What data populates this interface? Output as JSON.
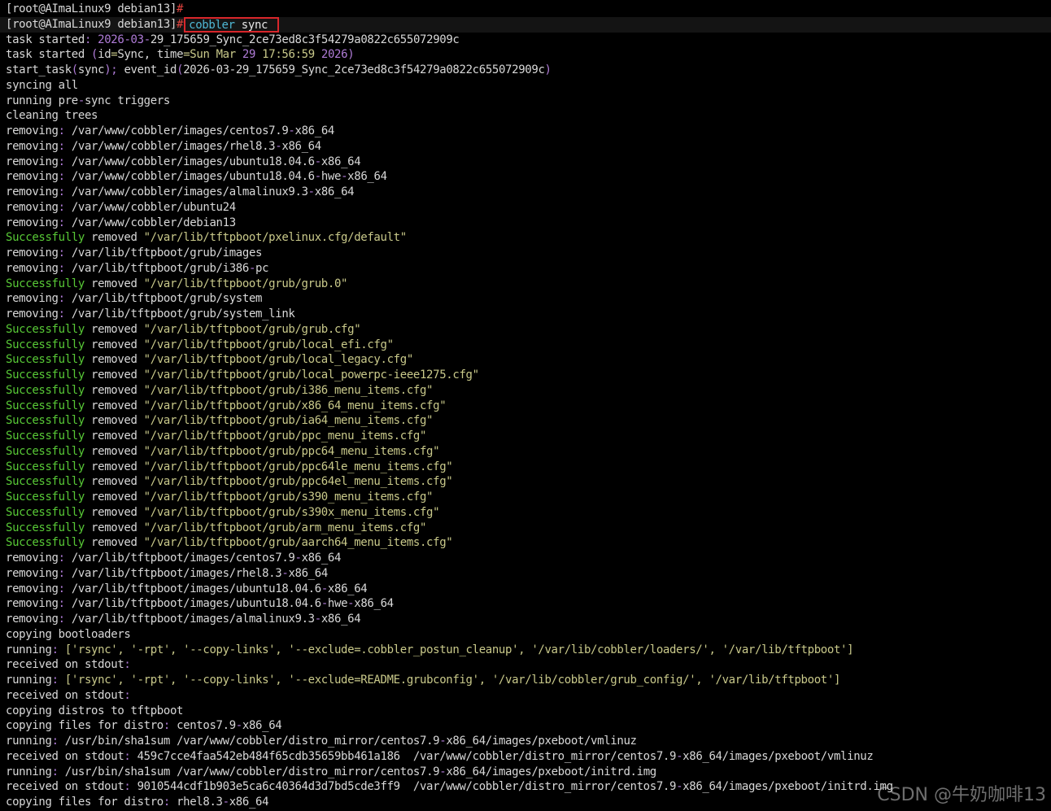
{
  "watermark": "CSDN @牛奶咖啡13",
  "colors": {
    "background": "#000000",
    "text": "#d8d8d8",
    "prompt_hash": "#e0433e",
    "command": "#4fb7d4",
    "success": "#58c936",
    "string": "#c9c98a",
    "number": "#b07cd8",
    "highlight_box": "#d9262b"
  },
  "lines": [
    {
      "segments": [
        {
          "t": "[root@AImaLinux9 debian13]",
          "c": "prompt"
        },
        {
          "t": "#",
          "c": "hash"
        }
      ]
    },
    {
      "current": true,
      "segments": [
        {
          "t": "[root@AImaLinux9 debian13]",
          "c": "prompt"
        },
        {
          "t": "#",
          "c": "hash"
        }
      ],
      "boxed": [
        {
          "t": "cobbler",
          "c": "cmd"
        },
        {
          "t": " sync",
          "c": "arg"
        }
      ]
    },
    {
      "segments": [
        {
          "t": "task started",
          "c": "plain"
        },
        {
          "t": ": ",
          "c": "punct"
        },
        {
          "t": "2026",
          "c": "num"
        },
        {
          "t": "-",
          "c": "punct"
        },
        {
          "t": "03",
          "c": "num"
        },
        {
          "t": "-",
          "c": "punct"
        },
        {
          "t": "29_175659_Sync_2ce73ed8c3f54279a0822c655072909c",
          "c": "plain"
        }
      ]
    },
    {
      "segments": [
        {
          "t": "task started ",
          "c": "plain"
        },
        {
          "t": "(",
          "c": "punct"
        },
        {
          "t": "id",
          "c": "plain"
        },
        {
          "t": "=",
          "c": "eq"
        },
        {
          "t": "Sync, time",
          "c": "plain"
        },
        {
          "t": "=",
          "c": "eq"
        },
        {
          "t": "Sun Mar ",
          "c": "date"
        },
        {
          "t": "29",
          "c": "num"
        },
        {
          "t": " 17:56:59 ",
          "c": "date"
        },
        {
          "t": "2026",
          "c": "num"
        },
        {
          "t": ")",
          "c": "punct"
        }
      ]
    },
    {
      "segments": [
        {
          "t": "start_task",
          "c": "plain"
        },
        {
          "t": "(",
          "c": "punct"
        },
        {
          "t": "sync",
          "c": "plain"
        },
        {
          "t": ");",
          "c": "punct"
        },
        {
          "t": " event_id",
          "c": "plain"
        },
        {
          "t": "(",
          "c": "punct"
        },
        {
          "t": "2026-03-29_175659_Sync_2ce73ed8c3f54279a0822c655072909c",
          "c": "plain"
        },
        {
          "t": ")",
          "c": "punct"
        }
      ]
    },
    {
      "segments": [
        {
          "t": "syncing all",
          "c": "plain"
        }
      ]
    },
    {
      "segments": [
        {
          "t": "running pre",
          "c": "plain"
        },
        {
          "t": "-",
          "c": "punct"
        },
        {
          "t": "sync triggers",
          "c": "plain"
        }
      ]
    },
    {
      "segments": [
        {
          "t": "cleaning trees",
          "c": "plain"
        }
      ]
    },
    {
      "segments": [
        {
          "t": "removing",
          "c": "plain"
        },
        {
          "t": ":",
          "c": "punct"
        },
        {
          "t": " /var/www/cobbler/images/centos7.9",
          "c": "plain"
        },
        {
          "t": "-",
          "c": "punct"
        },
        {
          "t": "x86_64",
          "c": "plain"
        }
      ]
    },
    {
      "segments": [
        {
          "t": "removing",
          "c": "plain"
        },
        {
          "t": ":",
          "c": "punct"
        },
        {
          "t": " /var/www/cobbler/images/rhel8.3",
          "c": "plain"
        },
        {
          "t": "-",
          "c": "punct"
        },
        {
          "t": "x86_64",
          "c": "plain"
        }
      ]
    },
    {
      "segments": [
        {
          "t": "removing",
          "c": "plain"
        },
        {
          "t": ":",
          "c": "punct"
        },
        {
          "t": " /var/www/cobbler/images/ubuntu18.04.6",
          "c": "plain"
        },
        {
          "t": "-",
          "c": "punct"
        },
        {
          "t": "x86_64",
          "c": "plain"
        }
      ]
    },
    {
      "segments": [
        {
          "t": "removing",
          "c": "plain"
        },
        {
          "t": ":",
          "c": "punct"
        },
        {
          "t": " /var/www/cobbler/images/ubuntu18.04.6",
          "c": "plain"
        },
        {
          "t": "-",
          "c": "punct"
        },
        {
          "t": "hwe",
          "c": "plain"
        },
        {
          "t": "-",
          "c": "punct"
        },
        {
          "t": "x86_64",
          "c": "plain"
        }
      ]
    },
    {
      "segments": [
        {
          "t": "removing",
          "c": "plain"
        },
        {
          "t": ":",
          "c": "punct"
        },
        {
          "t": " /var/www/cobbler/images/almalinux9.3",
          "c": "plain"
        },
        {
          "t": "-",
          "c": "punct"
        },
        {
          "t": "x86_64",
          "c": "plain"
        }
      ]
    },
    {
      "segments": [
        {
          "t": "removing",
          "c": "plain"
        },
        {
          "t": ":",
          "c": "punct"
        },
        {
          "t": " /var/www/cobbler/ubuntu24",
          "c": "plain"
        }
      ]
    },
    {
      "segments": [
        {
          "t": "removing",
          "c": "plain"
        },
        {
          "t": ":",
          "c": "punct"
        },
        {
          "t": " /var/www/cobbler/debian13",
          "c": "plain"
        }
      ]
    },
    {
      "segments": [
        {
          "t": "Successfully",
          "c": "green"
        },
        {
          "t": " removed ",
          "c": "plain"
        },
        {
          "t": "\"/var/lib/tftpboot/pxelinux.cfg/default\"",
          "c": "str"
        }
      ]
    },
    {
      "segments": [
        {
          "t": "removing",
          "c": "plain"
        },
        {
          "t": ":",
          "c": "punct"
        },
        {
          "t": " /var/lib/tftpboot/grub/images",
          "c": "plain"
        }
      ]
    },
    {
      "segments": [
        {
          "t": "removing",
          "c": "plain"
        },
        {
          "t": ":",
          "c": "punct"
        },
        {
          "t": " /var/lib/tftpboot/grub/i386",
          "c": "plain"
        },
        {
          "t": "-",
          "c": "punct"
        },
        {
          "t": "pc",
          "c": "plain"
        }
      ]
    },
    {
      "segments": [
        {
          "t": "Successfully",
          "c": "green"
        },
        {
          "t": " removed ",
          "c": "plain"
        },
        {
          "t": "\"/var/lib/tftpboot/grub/grub.0\"",
          "c": "str"
        }
      ]
    },
    {
      "segments": [
        {
          "t": "removing",
          "c": "plain"
        },
        {
          "t": ":",
          "c": "punct"
        },
        {
          "t": " /var/lib/tftpboot/grub/system",
          "c": "plain"
        }
      ]
    },
    {
      "segments": [
        {
          "t": "removing",
          "c": "plain"
        },
        {
          "t": ":",
          "c": "punct"
        },
        {
          "t": " /var/lib/tftpboot/grub/system_link",
          "c": "plain"
        }
      ]
    },
    {
      "segments": [
        {
          "t": "Successfully",
          "c": "green"
        },
        {
          "t": " removed ",
          "c": "plain"
        },
        {
          "t": "\"/var/lib/tftpboot/grub/grub.cfg\"",
          "c": "str"
        }
      ]
    },
    {
      "segments": [
        {
          "t": "Successfully",
          "c": "green"
        },
        {
          "t": " removed ",
          "c": "plain"
        },
        {
          "t": "\"/var/lib/tftpboot/grub/local_efi.cfg\"",
          "c": "str"
        }
      ]
    },
    {
      "segments": [
        {
          "t": "Successfully",
          "c": "green"
        },
        {
          "t": " removed ",
          "c": "plain"
        },
        {
          "t": "\"/var/lib/tftpboot/grub/local_legacy.cfg\"",
          "c": "str"
        }
      ]
    },
    {
      "segments": [
        {
          "t": "Successfully",
          "c": "green"
        },
        {
          "t": " removed ",
          "c": "plain"
        },
        {
          "t": "\"/var/lib/tftpboot/grub/local_powerpc-ieee1275.cfg\"",
          "c": "str"
        }
      ]
    },
    {
      "segments": [
        {
          "t": "Successfully",
          "c": "green"
        },
        {
          "t": " removed ",
          "c": "plain"
        },
        {
          "t": "\"/var/lib/tftpboot/grub/i386_menu_items.cfg\"",
          "c": "str"
        }
      ]
    },
    {
      "segments": [
        {
          "t": "Successfully",
          "c": "green"
        },
        {
          "t": " removed ",
          "c": "plain"
        },
        {
          "t": "\"/var/lib/tftpboot/grub/x86_64_menu_items.cfg\"",
          "c": "str"
        }
      ]
    },
    {
      "segments": [
        {
          "t": "Successfully",
          "c": "green"
        },
        {
          "t": " removed ",
          "c": "plain"
        },
        {
          "t": "\"/var/lib/tftpboot/grub/ia64_menu_items.cfg\"",
          "c": "str"
        }
      ]
    },
    {
      "segments": [
        {
          "t": "Successfully",
          "c": "green"
        },
        {
          "t": " removed ",
          "c": "plain"
        },
        {
          "t": "\"/var/lib/tftpboot/grub/ppc_menu_items.cfg\"",
          "c": "str"
        }
      ]
    },
    {
      "segments": [
        {
          "t": "Successfully",
          "c": "green"
        },
        {
          "t": " removed ",
          "c": "plain"
        },
        {
          "t": "\"/var/lib/tftpboot/grub/ppc64_menu_items.cfg\"",
          "c": "str"
        }
      ]
    },
    {
      "segments": [
        {
          "t": "Successfully",
          "c": "green"
        },
        {
          "t": " removed ",
          "c": "plain"
        },
        {
          "t": "\"/var/lib/tftpboot/grub/ppc64le_menu_items.cfg\"",
          "c": "str"
        }
      ]
    },
    {
      "segments": [
        {
          "t": "Successfully",
          "c": "green"
        },
        {
          "t": " removed ",
          "c": "plain"
        },
        {
          "t": "\"/var/lib/tftpboot/grub/ppc64el_menu_items.cfg\"",
          "c": "str"
        }
      ]
    },
    {
      "segments": [
        {
          "t": "Successfully",
          "c": "green"
        },
        {
          "t": " removed ",
          "c": "plain"
        },
        {
          "t": "\"/var/lib/tftpboot/grub/s390_menu_items.cfg\"",
          "c": "str"
        }
      ]
    },
    {
      "segments": [
        {
          "t": "Successfully",
          "c": "green"
        },
        {
          "t": " removed ",
          "c": "plain"
        },
        {
          "t": "\"/var/lib/tftpboot/grub/s390x_menu_items.cfg\"",
          "c": "str"
        }
      ]
    },
    {
      "segments": [
        {
          "t": "Successfully",
          "c": "green"
        },
        {
          "t": " removed ",
          "c": "plain"
        },
        {
          "t": "\"/var/lib/tftpboot/grub/arm_menu_items.cfg\"",
          "c": "str"
        }
      ]
    },
    {
      "segments": [
        {
          "t": "Successfully",
          "c": "green"
        },
        {
          "t": " removed ",
          "c": "plain"
        },
        {
          "t": "\"/var/lib/tftpboot/grub/aarch64_menu_items.cfg\"",
          "c": "str"
        }
      ]
    },
    {
      "segments": [
        {
          "t": "removing",
          "c": "plain"
        },
        {
          "t": ":",
          "c": "punct"
        },
        {
          "t": " /var/lib/tftpboot/images/centos7.9",
          "c": "plain"
        },
        {
          "t": "-",
          "c": "punct"
        },
        {
          "t": "x86_64",
          "c": "plain"
        }
      ]
    },
    {
      "segments": [
        {
          "t": "removing",
          "c": "plain"
        },
        {
          "t": ":",
          "c": "punct"
        },
        {
          "t": " /var/lib/tftpboot/images/rhel8.3",
          "c": "plain"
        },
        {
          "t": "-",
          "c": "punct"
        },
        {
          "t": "x86_64",
          "c": "plain"
        }
      ]
    },
    {
      "segments": [
        {
          "t": "removing",
          "c": "plain"
        },
        {
          "t": ":",
          "c": "punct"
        },
        {
          "t": " /var/lib/tftpboot/images/ubuntu18.04.6",
          "c": "plain"
        },
        {
          "t": "-",
          "c": "punct"
        },
        {
          "t": "x86_64",
          "c": "plain"
        }
      ]
    },
    {
      "segments": [
        {
          "t": "removing",
          "c": "plain"
        },
        {
          "t": ":",
          "c": "punct"
        },
        {
          "t": " /var/lib/tftpboot/images/ubuntu18.04.6",
          "c": "plain"
        },
        {
          "t": "-",
          "c": "punct"
        },
        {
          "t": "hwe",
          "c": "plain"
        },
        {
          "t": "-",
          "c": "punct"
        },
        {
          "t": "x86_64",
          "c": "plain"
        }
      ]
    },
    {
      "segments": [
        {
          "t": "removing",
          "c": "plain"
        },
        {
          "t": ":",
          "c": "punct"
        },
        {
          "t": " /var/lib/tftpboot/images/almalinux9.3",
          "c": "plain"
        },
        {
          "t": "-",
          "c": "punct"
        },
        {
          "t": "x86_64",
          "c": "plain"
        }
      ]
    },
    {
      "segments": [
        {
          "t": "copying bootloaders",
          "c": "plain"
        }
      ]
    },
    {
      "segments": [
        {
          "t": "running",
          "c": "plain"
        },
        {
          "t": ": ",
          "c": "punct"
        },
        {
          "t": "['rsync', '-rpt', '--copy-links', '--exclude=.cobbler_postun_cleanup', '/var/lib/cobbler/loaders/', '/var/lib/tftpboot']",
          "c": "str"
        }
      ]
    },
    {
      "segments": [
        {
          "t": "received on stdout",
          "c": "plain"
        },
        {
          "t": ":",
          "c": "punct"
        }
      ]
    },
    {
      "segments": [
        {
          "t": "running",
          "c": "plain"
        },
        {
          "t": ": ",
          "c": "punct"
        },
        {
          "t": "['rsync', '-rpt', '--copy-links', '--exclude=README.grubconfig', '/var/lib/cobbler/grub_config/', '/var/lib/tftpboot']",
          "c": "str"
        }
      ]
    },
    {
      "segments": [
        {
          "t": "received on stdout",
          "c": "plain"
        },
        {
          "t": ":",
          "c": "punct"
        }
      ]
    },
    {
      "segments": [
        {
          "t": "copying distros to tftpboot",
          "c": "plain"
        }
      ]
    },
    {
      "segments": [
        {
          "t": "copying files for distro",
          "c": "plain"
        },
        {
          "t": ":",
          "c": "punct"
        },
        {
          "t": " centos7.9",
          "c": "plain"
        },
        {
          "t": "-",
          "c": "punct"
        },
        {
          "t": "x86_64",
          "c": "plain"
        }
      ]
    },
    {
      "segments": [
        {
          "t": "running",
          "c": "plain"
        },
        {
          "t": ":",
          "c": "punct"
        },
        {
          "t": " /usr/bin/sha1sum /var/www/cobbler/distro_mirror/centos7.9",
          "c": "plain"
        },
        {
          "t": "-",
          "c": "punct"
        },
        {
          "t": "x86_64/images/pxeboot/vmlinuz",
          "c": "plain"
        }
      ]
    },
    {
      "segments": [
        {
          "t": "received on stdout",
          "c": "plain"
        },
        {
          "t": ":",
          "c": "punct"
        },
        {
          "t": " 459c7cce4faa542eb484f65cdb35659bb461a186  /var/www/cobbler/distro_mirror/centos7.9",
          "c": "plain"
        },
        {
          "t": "-",
          "c": "punct"
        },
        {
          "t": "x86_64/images/pxeboot/vmlinuz",
          "c": "plain"
        }
      ]
    },
    {
      "segments": [
        {
          "t": "running",
          "c": "plain"
        },
        {
          "t": ":",
          "c": "punct"
        },
        {
          "t": " /usr/bin/sha1sum /var/www/cobbler/distro_mirror/centos7.9",
          "c": "plain"
        },
        {
          "t": "-",
          "c": "punct"
        },
        {
          "t": "x86_64/images/pxeboot/initrd.img",
          "c": "plain"
        }
      ]
    },
    {
      "segments": [
        {
          "t": "received on stdout",
          "c": "plain"
        },
        {
          "t": ":",
          "c": "punct"
        },
        {
          "t": " 9010544cdf1b903e5ca6c40364d3d7bd5cde3ff9  /var/www/cobbler/distro_mirror/centos7.9",
          "c": "plain"
        },
        {
          "t": "-",
          "c": "punct"
        },
        {
          "t": "x86_64/images/pxeboot/initrd.img",
          "c": "plain"
        }
      ]
    },
    {
      "segments": [
        {
          "t": "copying files for distro",
          "c": "plain"
        },
        {
          "t": ":",
          "c": "punct"
        },
        {
          "t": " rhel8.3",
          "c": "plain"
        },
        {
          "t": "-",
          "c": "punct"
        },
        {
          "t": "x86_64",
          "c": "plain"
        }
      ]
    }
  ]
}
